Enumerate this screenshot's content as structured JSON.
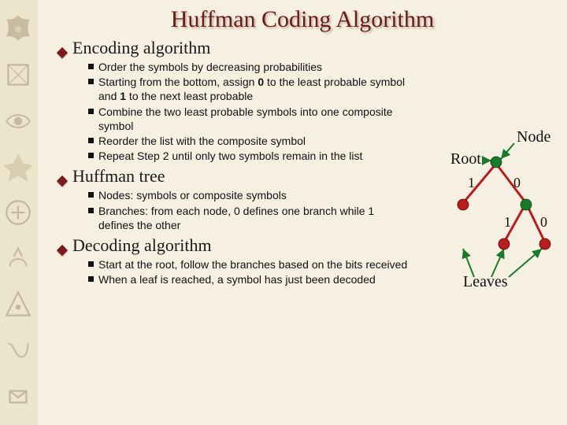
{
  "title": "Huffman Coding Algorithm",
  "sections": [
    {
      "heading": "Encoding algorithm",
      "bullets": [
        "Order the symbols by decreasing probabilities",
        "Starting from the bottom, assign <b>0</b> to the least probable symbol and <b>1</b> to the next least probable",
        "Combine the two least probable symbols into one composite symbol",
        "Reorder the list with the composite symbol",
        "Repeat Step 2 until only two symbols remain in the list"
      ]
    },
    {
      "heading": "Huffman tree",
      "bullets": [
        "Nodes: symbols or composite symbols",
        "Branches: from each node, 0 defines one branch while 1 defines the other"
      ]
    },
    {
      "heading": "Decoding algorithm",
      "bullets": [
        "Start at the root, follow the branches based on the bits received",
        "When a leaf is reached, a symbol has just been decoded"
      ]
    }
  ],
  "tree": {
    "label_node": "Node",
    "label_root": "Root",
    "label_leaves": "Leaves",
    "edge_left": "1",
    "edge_right": "0",
    "edge_left2": "1",
    "edge_right2": "0"
  }
}
